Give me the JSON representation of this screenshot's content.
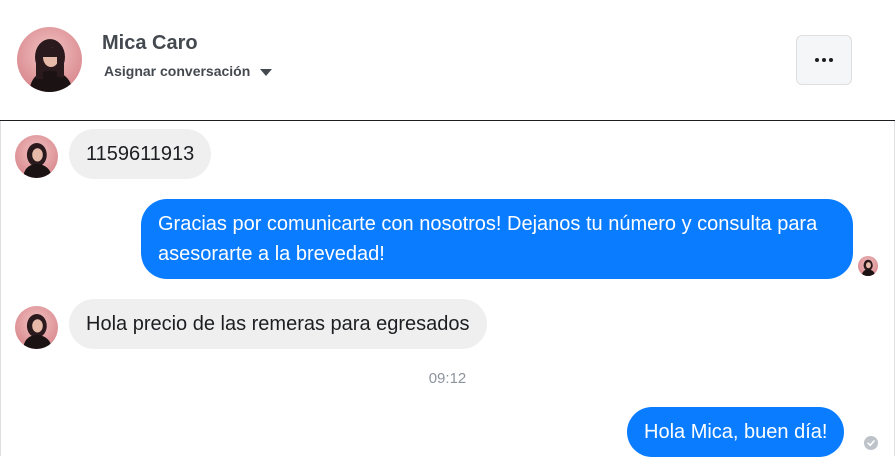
{
  "header": {
    "contact_name": "Mica Caro",
    "assign_label": "Asignar conversación",
    "more_button_label": "...",
    "icons": {
      "assign_dropdown": "caret-down-icon",
      "more": "more-options-icon"
    }
  },
  "messages": [
    {
      "direction": "incoming",
      "text": "1159611913"
    },
    {
      "direction": "outgoing",
      "text": "Gracias por comunicarte con nosotros! Dejanos tu número y consulta para asesorarte a la brevedad!"
    },
    {
      "direction": "incoming",
      "text": "Hola precio de las remeras para egresados"
    },
    {
      "direction": "outgoing",
      "text": "Hola Mica, buen día!"
    }
  ],
  "timestamp": "09:12",
  "colors": {
    "outgoing_bubble": "#0a7cff",
    "incoming_bubble": "#efefef",
    "text_dark": "#1c1e21",
    "timestamp": "#8d949e"
  }
}
